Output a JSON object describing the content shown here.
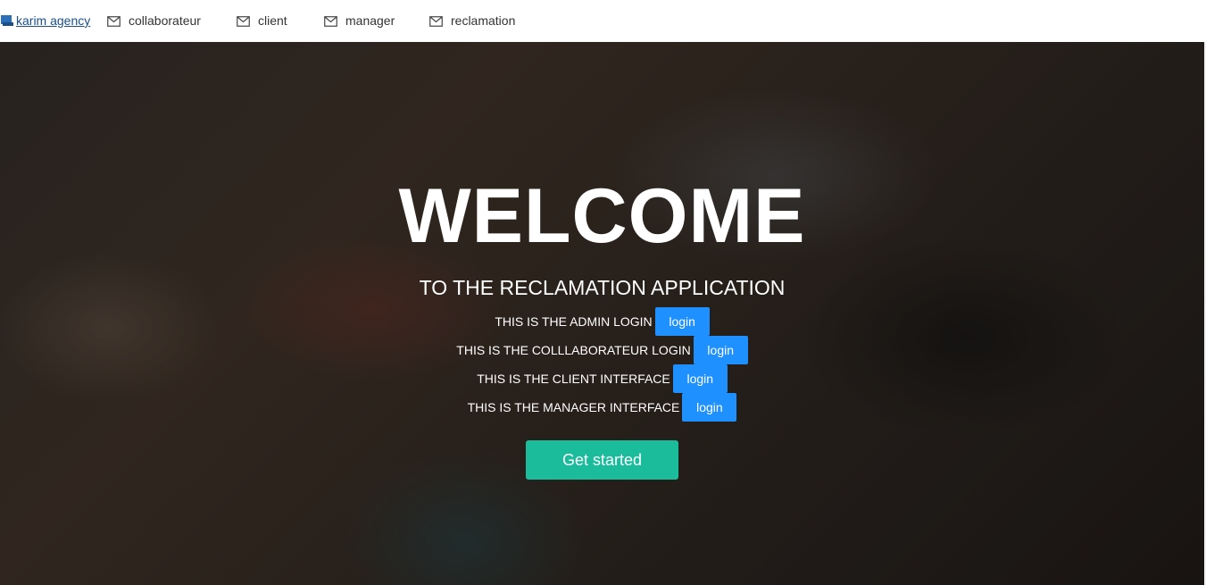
{
  "navbar": {
    "brand": {
      "label": "karim agency",
      "icon": "broken-image-icon"
    },
    "items": [
      {
        "label": "collaborateur",
        "icon": "mail-icon"
      },
      {
        "label": "client",
        "icon": "mail-icon"
      },
      {
        "label": "manager",
        "icon": "mail-icon"
      },
      {
        "label": "reclamation",
        "icon": "mail-icon"
      }
    ]
  },
  "hero": {
    "title": "WELCOME",
    "subtitle": "TO THE RECLAMATION APPLICATION",
    "logins": [
      {
        "label": "THIS IS THE ADMIN LOGIN",
        "button": "login"
      },
      {
        "label": "THIS IS THE COLLLABORATEUR LOGIN",
        "button": "login"
      },
      {
        "label": "THIS IS THE CLIENT INTERFACE",
        "button": "login"
      },
      {
        "label": "THIS IS THE MANAGER INTERFACE",
        "button": "login"
      }
    ],
    "cta": "Get started"
  },
  "colors": {
    "login_button": "#1e90ff",
    "cta_button": "#1abc9c",
    "brand_link": "#1a4f8b"
  }
}
